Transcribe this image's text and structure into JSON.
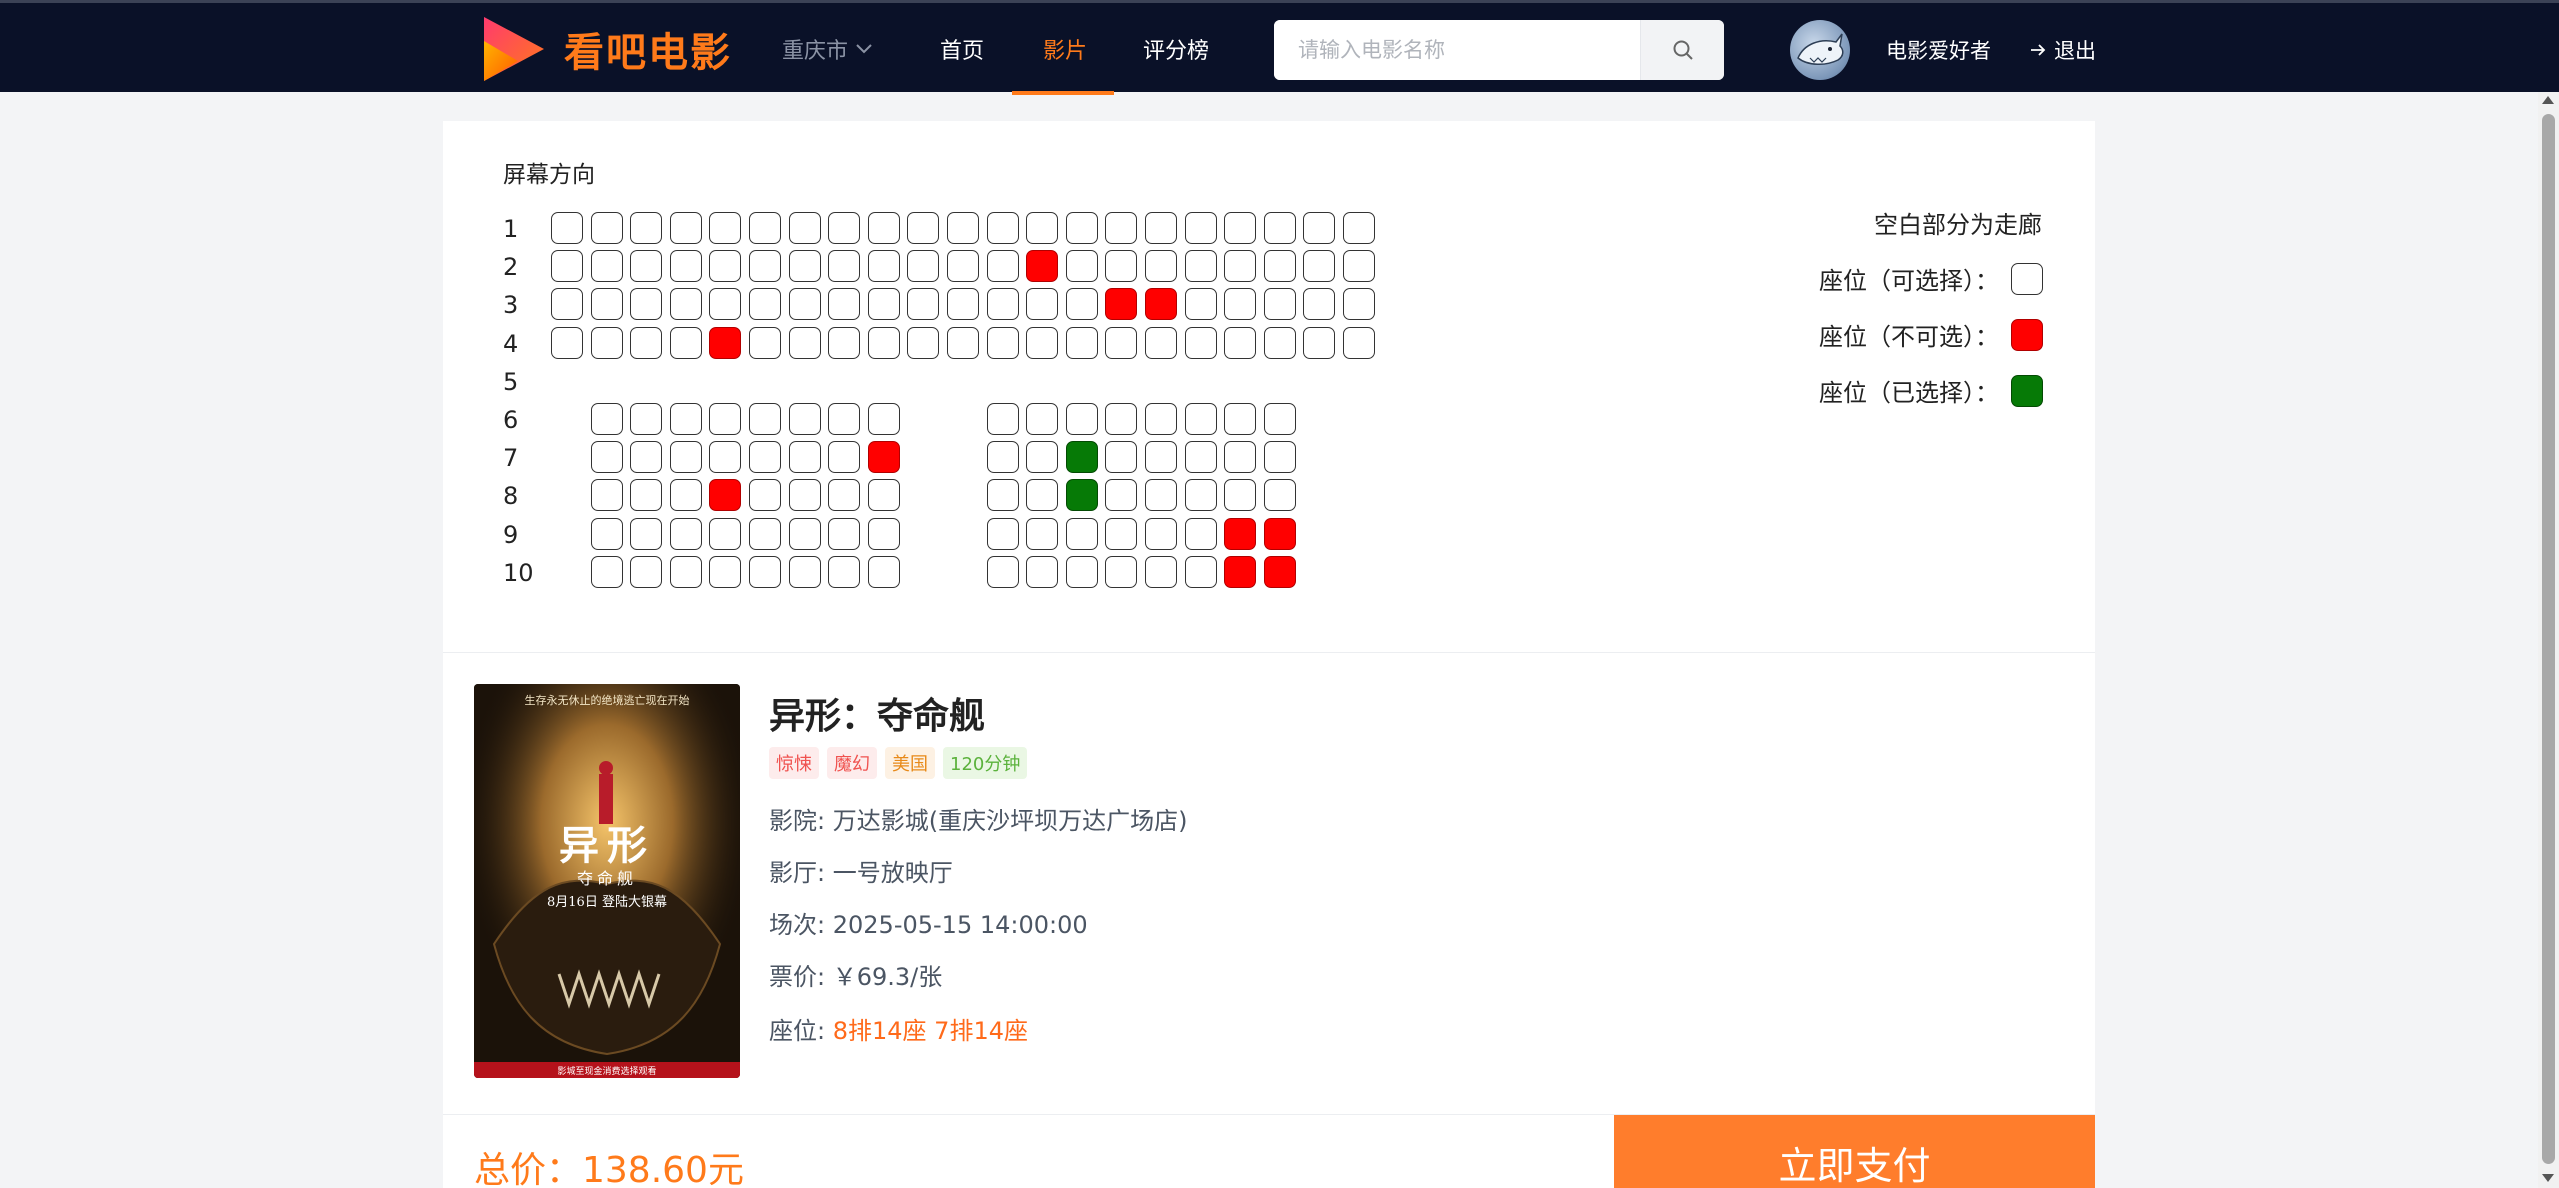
{
  "header": {
    "logo_text": "看吧电影",
    "city": "重庆市",
    "nav": [
      {
        "label": "首页",
        "active": false
      },
      {
        "label": "影片",
        "active": true
      },
      {
        "label": "评分榜",
        "active": false
      }
    ],
    "search_placeholder": "请输入电影名称",
    "username": "电影爱好者",
    "logout_label": "退出"
  },
  "seatmap": {
    "screen_label": "屏幕方向",
    "rows": [
      {
        "label": "1",
        "seats": "wwwwwwwwwwwwwwwwwwwww"
      },
      {
        "label": "2",
        "seats": "wwwwwwwwwwwwswwwwwwww"
      },
      {
        "label": "3",
        "seats": "wwwwwwwwwwwwwwsswwwww"
      },
      {
        "label": "4",
        "seats": "wwwwswwwwwwwwwwwwwwww"
      },
      {
        "label": "5",
        "seats": "_____________________"
      },
      {
        "label": "6",
        "seats": "_wwwwwwww__wwwwwwww__"
      },
      {
        "label": "7",
        "seats": "_wwwwwwws__wwgwwwww__"
      },
      {
        "label": "8",
        "seats": "_wwwswwww__wwgwwwww__"
      },
      {
        "label": "9",
        "seats": "_wwwwwwww__wwwwwwss__"
      },
      {
        "label": "10",
        "seats": "_wwwwwwww__wwwwwwss__"
      }
    ],
    "legend_title": "空白部分为走廊",
    "legend": [
      {
        "label": "座位（可选择）：",
        "state": "available"
      },
      {
        "label": "座位（不可选）：",
        "state": "sold"
      },
      {
        "label": "座位（已选择）：",
        "state": "selected"
      }
    ]
  },
  "movie": {
    "title": "异形：夺命舰",
    "tags": [
      {
        "text": "惊悚",
        "style": "red"
      },
      {
        "text": "魔幻",
        "style": "red"
      },
      {
        "text": "美国",
        "style": "orange"
      },
      {
        "text": "120分钟",
        "style": "green"
      }
    ],
    "cinema_label": "影院:",
    "cinema": "万达影城(重庆沙坪坝万达广场店)",
    "hall_label": "影厅:",
    "hall": "一号放映厅",
    "session_label": "场次:",
    "session": "2025-05-15 14:00:00",
    "price_label": "票价:",
    "price": "￥69.3/张",
    "seats_label": "座位:",
    "seats": "8排14座 7排14座",
    "poster": {
      "top_line": "生存永无休止的绝境逃亡现在开始",
      "title": "异形",
      "subtitle": "夺命舰",
      "date_line": "8月16日 登陆大银幕",
      "bottom_line": "影城至现金消费选择观看"
    }
  },
  "footer": {
    "total": "总价：138.60元",
    "pay_label": "立即支付"
  },
  "colors": {
    "header_bg": "#0a1128",
    "accent": "#ff7a1a",
    "seat_sold": "#ff0000",
    "seat_selected": "#067a06"
  }
}
